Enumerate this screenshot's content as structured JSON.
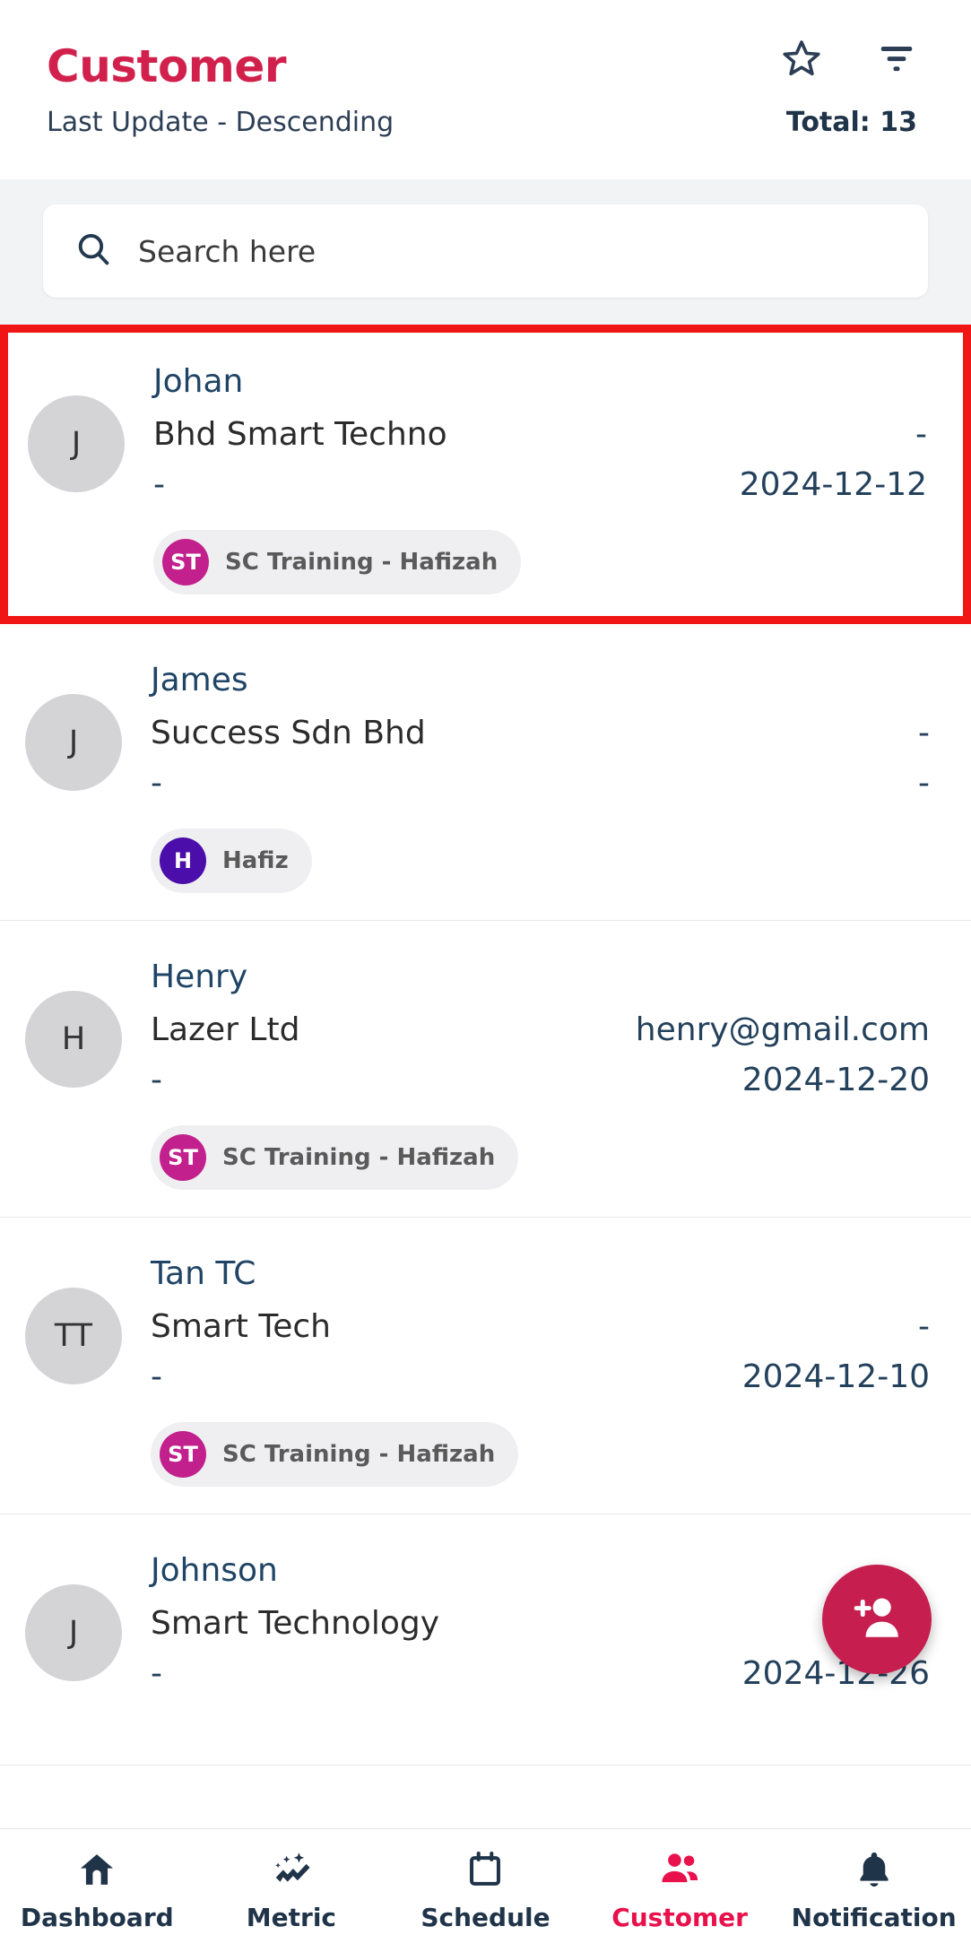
{
  "header": {
    "title": "Customer",
    "sort_label": "Last Update - Descending",
    "total_label": "Total: 13",
    "star_icon": "star-outline-icon",
    "filter_icon": "filter-icon"
  },
  "search": {
    "placeholder": "Search here",
    "value": "",
    "icon": "search-icon"
  },
  "colors": {
    "brand": "#D2204C",
    "accent": "#E8114B",
    "navy": "#1F3349",
    "highlight": "#F01616",
    "fab": "#C51E4F",
    "chip_st": "#C2208C",
    "chip_h": "#4B0EAB"
  },
  "customers": [
    {
      "initials": "J",
      "name": "Johan",
      "company": "Bhd     Smart Techno",
      "email": "-",
      "phone": "-",
      "date": "2024-12-12",
      "tag": {
        "initials": "ST",
        "label": "SC Training - Hafizah",
        "color": "#C2208C"
      },
      "highlighted": true
    },
    {
      "initials": "J",
      "name": "James",
      "company": "Success Sdn Bhd",
      "email": "-",
      "phone": "-",
      "date": "-",
      "tag": {
        "initials": "H",
        "label": "Hafiz",
        "color": "#4B0EAB"
      },
      "highlighted": false
    },
    {
      "initials": "H",
      "name": "Henry",
      "company": "Lazer Ltd",
      "email": "henry@gmail.com",
      "phone": "-",
      "date": "2024-12-20",
      "tag": {
        "initials": "ST",
        "label": "SC Training - Hafizah",
        "color": "#C2208C"
      },
      "highlighted": false
    },
    {
      "initials": "TT",
      "name": "Tan TC",
      "company": "Smart Tech",
      "email": "-",
      "phone": "-",
      "date": "2024-12-10",
      "tag": {
        "initials": "ST",
        "label": "SC Training - Hafizah",
        "color": "#C2208C"
      },
      "highlighted": false
    },
    {
      "initials": "J",
      "name": "Johnson",
      "company": "Smart Technology",
      "email": "",
      "phone": "-",
      "date": "2024-12-26",
      "tag": null,
      "highlighted": false
    }
  ],
  "fab": {
    "label": "Add Customer",
    "icon": "add-person-icon"
  },
  "bottom_nav": [
    {
      "label": "Dashboard",
      "icon": "home-icon",
      "active": false
    },
    {
      "label": "Metric",
      "icon": "metric-sparkle-icon",
      "active": false
    },
    {
      "label": "Schedule",
      "icon": "calendar-icon",
      "active": false
    },
    {
      "label": "Customer",
      "icon": "people-icon",
      "active": true
    },
    {
      "label": "Notification",
      "icon": "bell-icon",
      "active": false
    }
  ]
}
